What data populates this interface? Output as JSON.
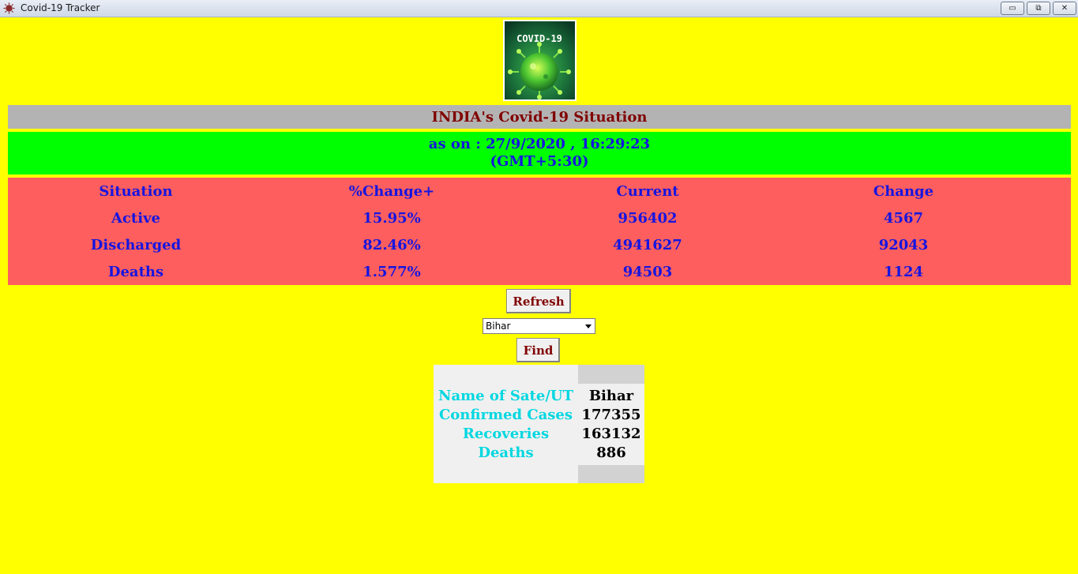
{
  "window": {
    "title": "Covid-19 Tracker",
    "controls": {
      "minimize": "▭",
      "maximize": "⧉",
      "close": "✕"
    }
  },
  "logo": {
    "text": "COVID-19",
    "icon": "virus-icon"
  },
  "heading": "INDIA's Covid-19 Situation",
  "timestamp": {
    "line1": "as on : 27/9/2020 , 16:29:23",
    "line2": "(GMT+5:30)"
  },
  "stats": {
    "headers": [
      "Situation",
      "%Change+",
      "Current",
      "Change"
    ],
    "rows": [
      {
        "situation": "Active",
        "percent": "15.95%",
        "current": "956402",
        "change": "4567"
      },
      {
        "situation": "Discharged",
        "percent": "82.46%",
        "current": "4941627",
        "change": "92043"
      },
      {
        "situation": "Deaths",
        "percent": "1.577%",
        "current": "94503",
        "change": "1124"
      }
    ]
  },
  "refresh_label": "Refresh",
  "state_select": {
    "value": "Bihar"
  },
  "find_label": "Find",
  "result": {
    "name_label": "Name of Sate/UT",
    "name_value": "Bihar",
    "confirmed_label": "Confirmed Cases",
    "confirmed_value": "177355",
    "recoveries_label": "Recoveries",
    "recoveries_value": "163132",
    "deaths_label": "Deaths",
    "deaths_value": "886"
  },
  "colors": {
    "background": "#ffff00",
    "heading_bg": "#b3b3b3",
    "heading_text": "#800000",
    "date_bg": "#00ff00",
    "stats_bg": "#ff5e5e",
    "stats_text": "#1515e0",
    "result_label": "#00d7e0"
  }
}
